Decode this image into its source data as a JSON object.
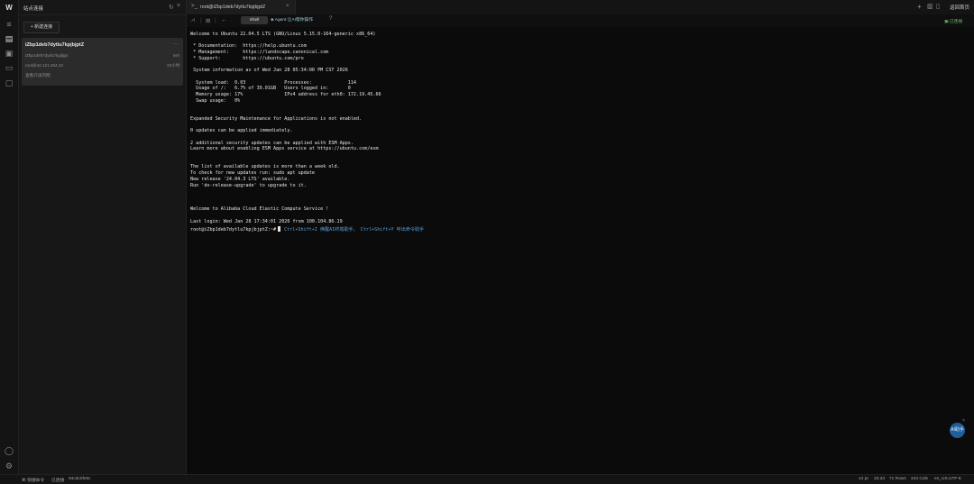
{
  "app": {
    "logo": "W"
  },
  "rail": {
    "icons": [
      "server-icon",
      "layers-icon",
      "folder-icon",
      "monitor-icon"
    ],
    "bottom_icons": [
      "user-icon",
      "gear-icon"
    ]
  },
  "left_panel": {
    "title": "站点连接",
    "new_button": "+ 新建连接",
    "card": {
      "name": "iZbp1deb7dytlu7kpjbjptZ",
      "host": "iZbp1deb7dytlu7kpjbjpt",
      "protocol": "ssh",
      "user_host": "root@42.121.254.43",
      "time": "23小时",
      "note": "查看只读内网"
    }
  },
  "tabbar": {
    "tab_label": "root@iZbp1deb7dytlu7kpjbjptZ",
    "back_label": "返回首页"
  },
  "toolbar": {
    "shell_label": "Shell",
    "agent_label": "Agent 让AI帮你操作",
    "status": "已连接"
  },
  "terminal": {
    "lines": [
      "Welcome to Ubuntu 22.04.5 LTS (GNU/Linux 5.15.0-164-generic x86_64)",
      "",
      " * Documentation:  https://help.ubuntu.com",
      " * Management:     https://landscape.canonical.com",
      " * Support:        https://ubuntu.com/pro",
      "",
      " System information as of Wed Jan 28 05:34:00 PM CST 2026",
      "",
      "  System load:  0.03              Processes:             114",
      "  Usage of /:   6.7% of 39.01GB   Users logged in:       0",
      "  Memory usage: 17%               IPv4 address for eth0: 172.19.45.66",
      "  Swap usage:   0%",
      "",
      "",
      "Expanded Security Maintenance for Applications is not enabled.",
      "",
      "0 updates can be applied immediately.",
      "",
      "2 additional security updates can be applied with ESM Apps.",
      "Learn more about enabling ESM Apps service at https://ubuntu.com/esm",
      "",
      "",
      "The list of available updates is more than a week old.",
      "To check for new updates run: sudo apt update",
      "New release '24.04.3 LTS' available.",
      "Run 'do-release-upgrade' to upgrade to it.",
      "",
      "",
      "",
      "Welcome to Alibaba Cloud Elastic Compute Service !",
      "",
      "Last login: Wed Jan 28 17:34:01 2026 from 100.104.86.19"
    ],
    "prompt": "root@iZbp1deb7dytlu7kpjbjptZ:~#",
    "hint": "Ctrl+Shift+I 唤醒AI终端助手， Ctrl+Shift+Y 呼出命令助手"
  },
  "ai_button": "AI助手",
  "statusbar": {
    "quick_cmd": "快捷命令",
    "connected": "已连接",
    "session": "94cdc0fe6c",
    "font_size": "14 pt",
    "cursor": "33,33",
    "rows": "71 Rows",
    "cols": "243 Cols",
    "encoding": "en_US.UTF-8"
  }
}
